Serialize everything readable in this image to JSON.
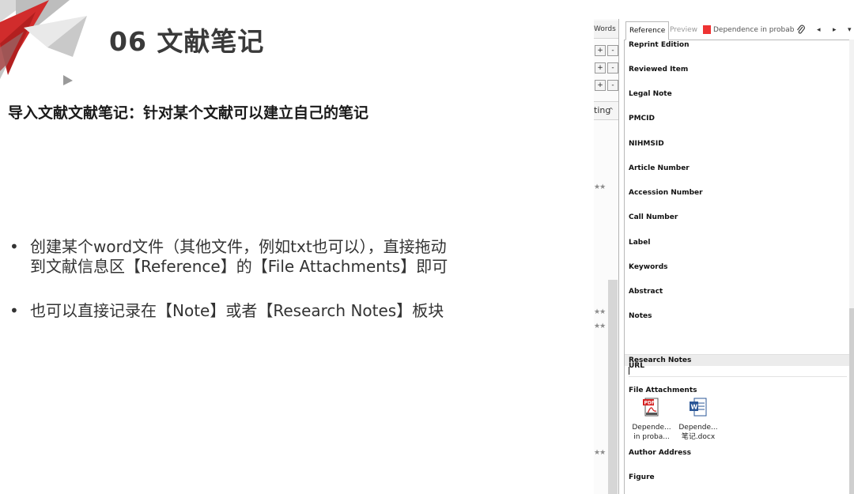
{
  "slide": {
    "title": "06 文献笔记",
    "subtitle": "导入文献文献笔记：针对某个文献可以建立自己的笔记",
    "bullets": [
      {
        "marker": "•",
        "line1": "创建某个word文件（其他文件，例如txt也可以），直接拖动",
        "line2": "到文献信息区【Reference】的【File Attachments】即可"
      },
      {
        "marker": "•",
        "line1": "也可以直接记录在【Note】或者【Research Notes】板块",
        "line2": ""
      }
    ],
    "colors": {
      "logo_red": "#d12c2c",
      "logo_gray": "#9a9a9a",
      "title": "#3a3a3a"
    }
  },
  "endnote": {
    "left_pane": {
      "column_header": "Words",
      "buttons": [
        {
          "plus": "+",
          "minus": "-"
        },
        {
          "plus": "+",
          "minus": "-"
        },
        {
          "plus": "+",
          "minus": "-"
        }
      ],
      "sort_column": "ting",
      "sort_caret": "^",
      "rating_rows": [
        "★★",
        "★★",
        "★★",
        "★★"
      ]
    },
    "tabs": {
      "reference": "Reference",
      "preview": "Preview",
      "pdf": "Dependence in probab",
      "attach_icon": "paperclip-icon",
      "prev": "◂",
      "next": "▸",
      "menu": "▾"
    },
    "fields": [
      "Reprint Edition",
      "Reviewed Item",
      "Legal Note",
      "PMCID",
      "NIHMSID",
      "Article Number",
      "Accession Number",
      "Call Number",
      "Label",
      "Keywords",
      "Abstract",
      "Notes",
      "Research Notes",
      "URL",
      "File Attachments",
      "Author Address",
      "Figure"
    ],
    "attachments": [
      {
        "icon": "pdf-file-icon",
        "line1": "Depende...",
        "line2": "in proba..."
      },
      {
        "icon": "word-file-icon",
        "line1": "Depende...",
        "line2": "笔记.docx"
      }
    ]
  }
}
